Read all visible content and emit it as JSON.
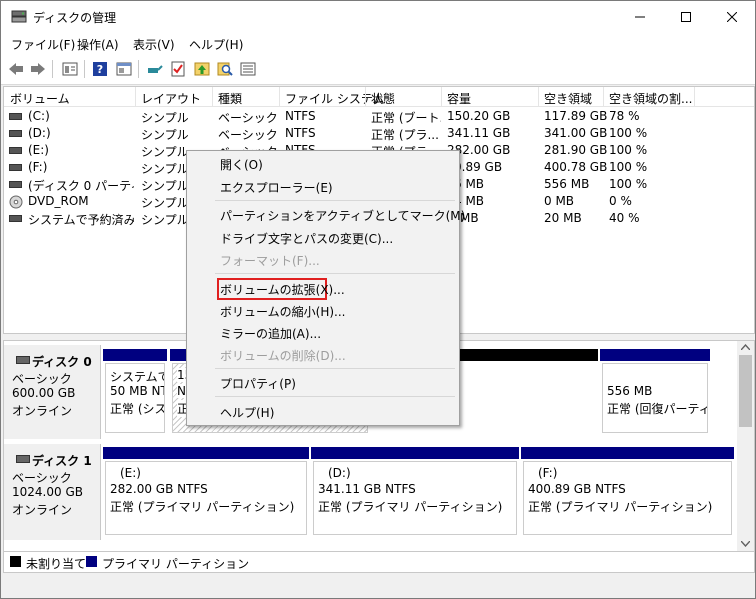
{
  "window": {
    "title": "ディスクの管理"
  },
  "menu": [
    "ファイル(F)",
    "操作(A)",
    "表示(V)",
    "ヘルプ(H)"
  ],
  "toolbar_icons": [
    "back-icon",
    "forward-icon",
    "view-icon",
    "help-icon",
    "properties-icon",
    "connect-icon",
    "check-icon",
    "disk-icon",
    "search-icon",
    "list-icon"
  ],
  "volume_table": {
    "columns": [
      "ボリューム",
      "レイアウト",
      "種類",
      "ファイル システム",
      "状態",
      "容量",
      "空き領域",
      "空き領域の割..."
    ],
    "rows": [
      {
        "name": "(C:)",
        "layout": "シンプル",
        "type": "ベーシック",
        "fs": "NTFS",
        "status": "正常 (ブート...",
        "capacity": "150.20 GB",
        "free": "117.89 GB",
        "pct": "78 %"
      },
      {
        "name": "(D:)",
        "layout": "シンプル",
        "type": "ベーシック",
        "fs": "NTFS",
        "status": "正常 (プラ...",
        "capacity": "341.11 GB",
        "free": "341.00 GB",
        "pct": "100 %"
      },
      {
        "name": "(E:)",
        "layout": "シンプル",
        "type": "ベーシック",
        "fs": "NTFS",
        "status": "正常 (プラ...",
        "capacity": "282.00 GB",
        "free": "281.90 GB",
        "pct": "100 %"
      },
      {
        "name": "(F:)",
        "layout": "シンプル",
        "type": "",
        "fs": "",
        "status": "",
        "capacity": "0.89 GB",
        "free": "400.78 GB",
        "pct": "100 %"
      },
      {
        "name": "(ディスク 0 パーティシ...",
        "layout": "シンプル",
        "type": "",
        "fs": "",
        "status": "",
        "capacity": "6 MB",
        "free": "556 MB",
        "pct": "100 %"
      },
      {
        "name": "DVD_ROM",
        "layout": "シンプル",
        "type": "",
        "fs": "",
        "status": "",
        "capacity": "4 MB",
        "free": "0 MB",
        "pct": "0 %"
      },
      {
        "name": "システムで予約済み",
        "layout": "シンプル",
        "type": "",
        "fs": "",
        "status": "",
        "capacity": "MB",
        "free": "20 MB",
        "pct": "40 %"
      }
    ]
  },
  "disks": [
    {
      "name": "ディスク 0",
      "type": "ベーシック",
      "size": "600.00 GB",
      "state": "オンライン",
      "partitions": [
        {
          "lines": [
            "システムで予",
            "50 MB NT",
            "正常 (シス"
          ]
        },
        {
          "lines": [
            "15",
            "N",
            "正"
          ]
        },
        {
          "lines": [
            "556 MB",
            "正常 (回復パーティシ"
          ]
        }
      ]
    },
    {
      "name": "ディスク 1",
      "type": "ベーシック",
      "size": "1024.00 GB",
      "state": "オンライン",
      "partitions": [
        {
          "lines": [
            "(E:)",
            "282.00 GB NTFS",
            "正常 (プライマリ パーティション)"
          ]
        },
        {
          "lines": [
            "(D:)",
            "341.11 GB NTFS",
            "正常 (プライマリ パーティション)"
          ]
        },
        {
          "lines": [
            "(F:)",
            "400.89 GB NTFS",
            "正常 (プライマリ パーティション)"
          ]
        }
      ]
    }
  ],
  "legend": {
    "unallocated": "未割り当て",
    "primary": "プライマリ パーティション"
  },
  "context_menu": [
    {
      "label": "開く(O)",
      "enabled": true
    },
    {
      "label": "エクスプローラー(E)",
      "enabled": true
    },
    {
      "label": "パーティションをアクティブとしてマーク(M)",
      "enabled": true
    },
    {
      "label": "ドライブ文字とパスの変更(C)...",
      "enabled": true
    },
    {
      "label": "フォーマット(F)...",
      "enabled": false
    },
    {
      "label": "ボリュームの拡張(X)...",
      "enabled": true,
      "highlighted": true
    },
    {
      "label": "ボリュームの縮小(H)...",
      "enabled": true
    },
    {
      "label": "ミラーの追加(A)...",
      "enabled": true
    },
    {
      "label": "ボリュームの削除(D)...",
      "enabled": false
    },
    {
      "label": "プロパティ(P)",
      "enabled": true
    },
    {
      "label": "ヘルプ(H)",
      "enabled": true
    }
  ],
  "colors": {
    "primary_partition": "#000080",
    "unallocated": "#000000",
    "highlight_box": "#e02020"
  }
}
